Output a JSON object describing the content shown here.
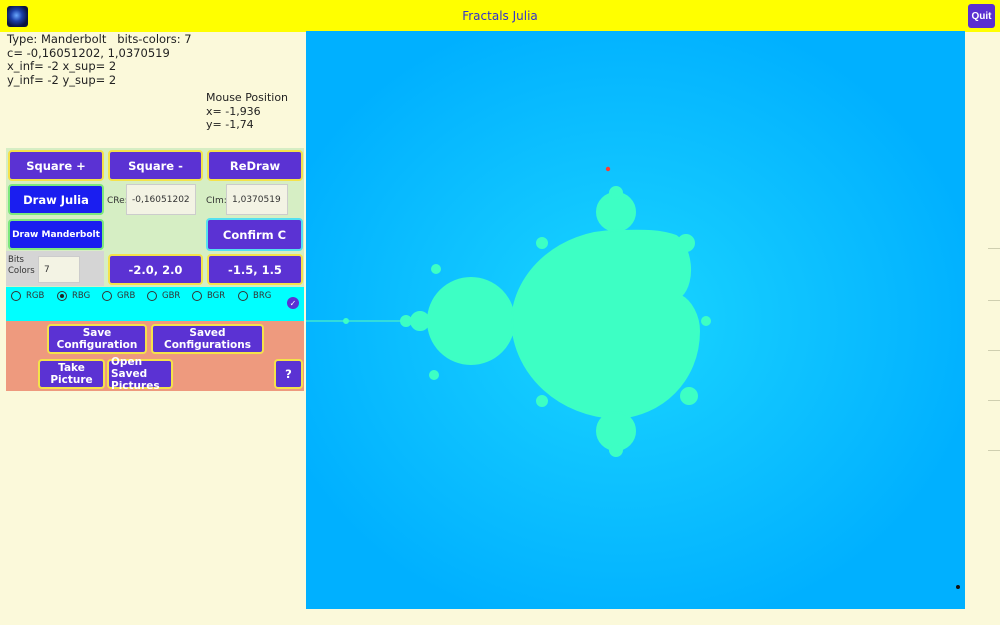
{
  "window": {
    "title": "Fractals Julia",
    "quit_label": "Quit"
  },
  "info": {
    "line1": "Type: Manderbolt   bits-colors: 7",
    "line2": "c= -0,16051202, 1,0370519",
    "line3": "x_inf= -2 x_sup= 2",
    "line4": "y_inf= -2 y_sup= 2"
  },
  "mouse": {
    "title": "Mouse Position",
    "x": "x= -1,936",
    "y": "y= -1,74"
  },
  "buttons": {
    "square_plus": "Square +",
    "square_minus": "Square -",
    "redraw": "ReDraw",
    "draw_julia": "Draw Julia",
    "draw_manderbolt": "Draw Manderbolt",
    "confirm_c": "Confirm C",
    "range_a": "-2.0, 2.0",
    "range_b": "-1.5, 1.5",
    "save_config": "Save Configuration",
    "saved_configs": "Saved Configurations",
    "take_picture": "Take Picture",
    "open_saved": "Open Saved Pictures",
    "help": "?"
  },
  "fields": {
    "cre_label": "CRe:",
    "cre_value": "-0,16051202",
    "cim_label": "CIm:",
    "cim_value": "1,0370519",
    "bits_label": "Bits Colors",
    "bits_value": "7"
  },
  "color_modes": {
    "options": [
      "RGB",
      "RBG",
      "GRB",
      "GBR",
      "BGR",
      "BRG"
    ],
    "selected": "RBG"
  },
  "colors": {
    "accent": "#5b32d3",
    "title_bar": "#ffff00",
    "canvas_bg": "#00b0ff",
    "fractal": "#3dffc4"
  }
}
